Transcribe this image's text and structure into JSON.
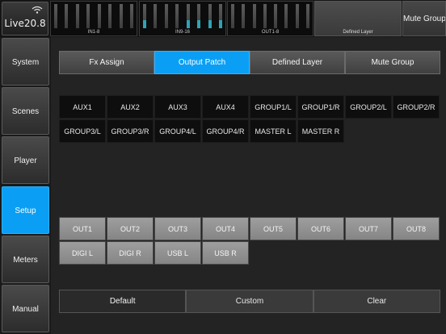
{
  "app": {
    "logo_text": "Live20.8"
  },
  "topbar": {
    "groups": [
      {
        "label": "IN1-8"
      },
      {
        "label": "IN9-16"
      },
      {
        "label": "OUT1-8"
      }
    ],
    "layer_label": "Defined  Layer",
    "mute_group_label": "Mute Group"
  },
  "sidebar": {
    "items": [
      {
        "label": "System"
      },
      {
        "label": "Scenes"
      },
      {
        "label": "Player"
      },
      {
        "label": "Setup"
      },
      {
        "label": "Meters"
      },
      {
        "label": "Manual"
      }
    ],
    "active": "Setup"
  },
  "tabs": [
    {
      "label": "Fx Assign"
    },
    {
      "label": "Output Patch"
    },
    {
      "label": "Defined Layer"
    },
    {
      "label": "Mute Group"
    }
  ],
  "active_tab": "Output Patch",
  "sources": [
    "AUX1",
    "AUX2",
    "AUX3",
    "AUX4",
    "GROUP1/L",
    "GROUP1/R",
    "GROUP2/L",
    "GROUP2/R",
    "GROUP3/L",
    "GROUP3/R",
    "GROUP4/L",
    "GROUP4/R",
    "MASTER L",
    "MASTER R"
  ],
  "outputs": [
    "OUT1",
    "OUT2",
    "OUT3",
    "OUT4",
    "OUT5",
    "OUT6",
    "OUT7",
    "OUT8",
    "DIGI L",
    "DIGI R",
    "USB L",
    "USB R"
  ],
  "presets": [
    {
      "label": "Default"
    },
    {
      "label": "Custom"
    },
    {
      "label": "Clear"
    }
  ],
  "selected_preset": "Default",
  "colors": {
    "accent": "#0a9ff5",
    "output_button": "#949494",
    "source_button": "#0e0e0e"
  }
}
